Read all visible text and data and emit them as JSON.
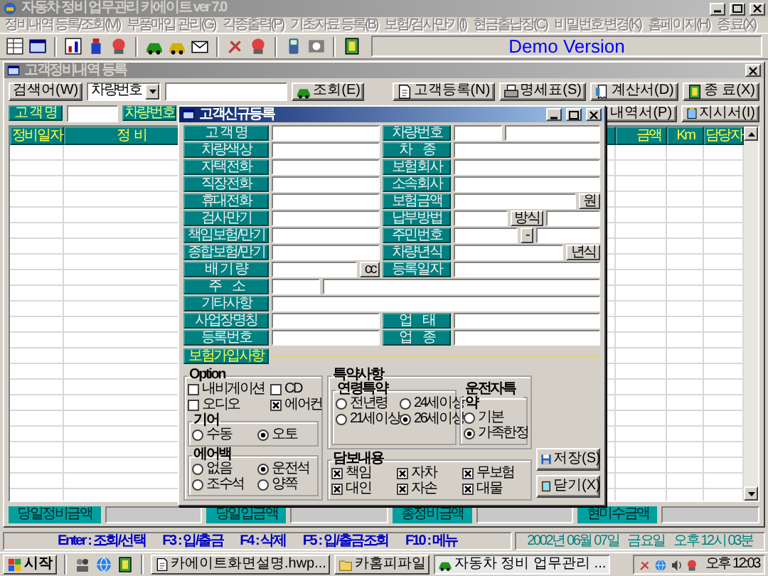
{
  "window": {
    "title": "자동차 정비 업무관리 카에이트 ver 7.0"
  },
  "menu": [
    "정비내역 등록/조회(M)",
    "부품매입 관리(G)",
    "각종출력(P)",
    "기초자료 등록(B)",
    "보험/검사만기(I)",
    "현금출납장(C)",
    "비밀번호 변경(K)",
    "홈페이지(H)",
    "종 료(X)"
  ],
  "toolbar": {
    "banner": "Demo Version"
  },
  "child_window": {
    "title": "고객정비내역 등록"
  },
  "search": {
    "button": "검색어(W)",
    "field": "차량번호",
    "lookup_button": "조회(E)"
  },
  "actions_top": [
    {
      "label": "고객등록(N)",
      "kind": "document"
    },
    {
      "label": "명세표(S)",
      "kind": "printer"
    },
    {
      "label": "계산서(D)",
      "kind": "receipt"
    },
    {
      "label": "종  료(X)",
      "kind": "exit"
    }
  ],
  "actions_bottom": [
    {
      "label": "내역서(P)",
      "kind": "notepad"
    },
    {
      "label": "지시서(I)",
      "kind": "clipboard"
    }
  ],
  "filter": {
    "name_label": "고 객 명",
    "plate_label": "차량번호"
  },
  "table": {
    "columns": [
      "정비일자",
      "정  비",
      "금액",
      "Km",
      "담당자"
    ]
  },
  "totals": [
    "당일정비금액",
    "당일입금액",
    "총정비금액",
    "현미수금액"
  ],
  "dialog": {
    "title": "고객신규등록",
    "left_fields": [
      {
        "label": "고 객 명",
        "kind": "text"
      },
      {
        "label": "차량색상",
        "kind": "text"
      },
      {
        "label": "자택전화",
        "kind": "text"
      },
      {
        "label": "직장전화",
        "kind": "text"
      },
      {
        "label": "휴대전화",
        "kind": "text"
      },
      {
        "label": "검사만기",
        "kind": "text"
      },
      {
        "label": "책임보험/만기",
        "kind": "text"
      },
      {
        "label": "종합보험/만기",
        "kind": "text"
      },
      {
        "label": "배 기 량",
        "kind": "unit",
        "unit": "cc"
      }
    ],
    "right_fields": [
      {
        "label": "차량번호",
        "kind": "split"
      },
      {
        "label": "차     종",
        "kind": "text"
      },
      {
        "label": "보험회사",
        "kind": "text"
      },
      {
        "label": "소속회사",
        "kind": "text"
      },
      {
        "label": "보험금액",
        "kind": "unit",
        "unit": "원"
      },
      {
        "label": "납부방법",
        "kind": "unit_input",
        "unit": "방식"
      },
      {
        "label": "주민번호",
        "kind": "unit_input",
        "unit": "-"
      },
      {
        "label": "차량년식",
        "kind": "unit",
        "unit": "년식"
      },
      {
        "label": "등록일자",
        "kind": "text"
      }
    ],
    "wide_fields": [
      {
        "label": "주     소",
        "kind": "split"
      },
      {
        "label": "기타사항",
        "kind": "text"
      }
    ],
    "business_fields": [
      {
        "label": "사업장명칭",
        "side_label": "업     태"
      },
      {
        "label": "등록번호",
        "side_label": "업     종"
      }
    ],
    "section": "보험가입사항",
    "option": {
      "title": "Option",
      "items": [
        {
          "label": "내비게이션",
          "checked": false
        },
        {
          "label": "CD",
          "checked": false
        },
        {
          "label": "오디오",
          "checked": false
        },
        {
          "label": "에어컨",
          "checked": true
        }
      ],
      "gear": {
        "title": "기어",
        "choices": [
          {
            "label": "수동",
            "selected": false
          },
          {
            "label": "오토",
            "selected": true
          }
        ]
      },
      "airbag": {
        "title": "에어백",
        "choices": [
          {
            "label": "없음",
            "selected": false
          },
          {
            "label": "운전석",
            "selected": true
          },
          {
            "label": "조수석",
            "selected": false
          },
          {
            "label": "양쪽",
            "selected": false
          }
        ]
      }
    },
    "special": {
      "title": "특약사항",
      "age": {
        "title": "연령특약",
        "choices": [
          {
            "label": "전년령",
            "selected": false
          },
          {
            "label": "24세이상",
            "selected": false
          },
          {
            "label": "21세이상",
            "selected": false
          },
          {
            "label": "26세이상",
            "selected": true
          }
        ]
      },
      "driver": {
        "title": "운전자특약",
        "choices": [
          {
            "label": "기본",
            "selected": false
          },
          {
            "label": "가족한정",
            "selected": true
          }
        ]
      }
    },
    "coverage": {
      "title": "담보내용",
      "items": [
        {
          "label": "책임",
          "checked": true
        },
        {
          "label": "자차",
          "checked": true
        },
        {
          "label": "무보험",
          "checked": true
        },
        {
          "label": "대인",
          "checked": true
        },
        {
          "label": "자손",
          "checked": true
        },
        {
          "label": "대물",
          "checked": true
        }
      ]
    },
    "buttons": [
      {
        "label": "저장(S)",
        "kind": "save"
      },
      {
        "label": "닫기(X)",
        "kind": "close"
      }
    ]
  },
  "status_bar": {
    "hints": [
      "Enter : 조회/선택",
      "F3 : 입/출금",
      "F4 : 삭제",
      "F5 : 입/출금조회",
      "F10 : 메뉴"
    ],
    "date": "2002년 06월 07일",
    "weekday": "금요일",
    "time": "오후 12시 03분"
  },
  "taskbar": {
    "start": "시작",
    "tasks": [
      {
        "label": "카에이트화면설명.hwp...",
        "selected": false
      },
      {
        "label": "카홈피파일",
        "selected": false
      },
      {
        "label": "자동차 정비 업무관리 ...",
        "selected": true
      }
    ],
    "clock": "오후 12:03"
  }
}
